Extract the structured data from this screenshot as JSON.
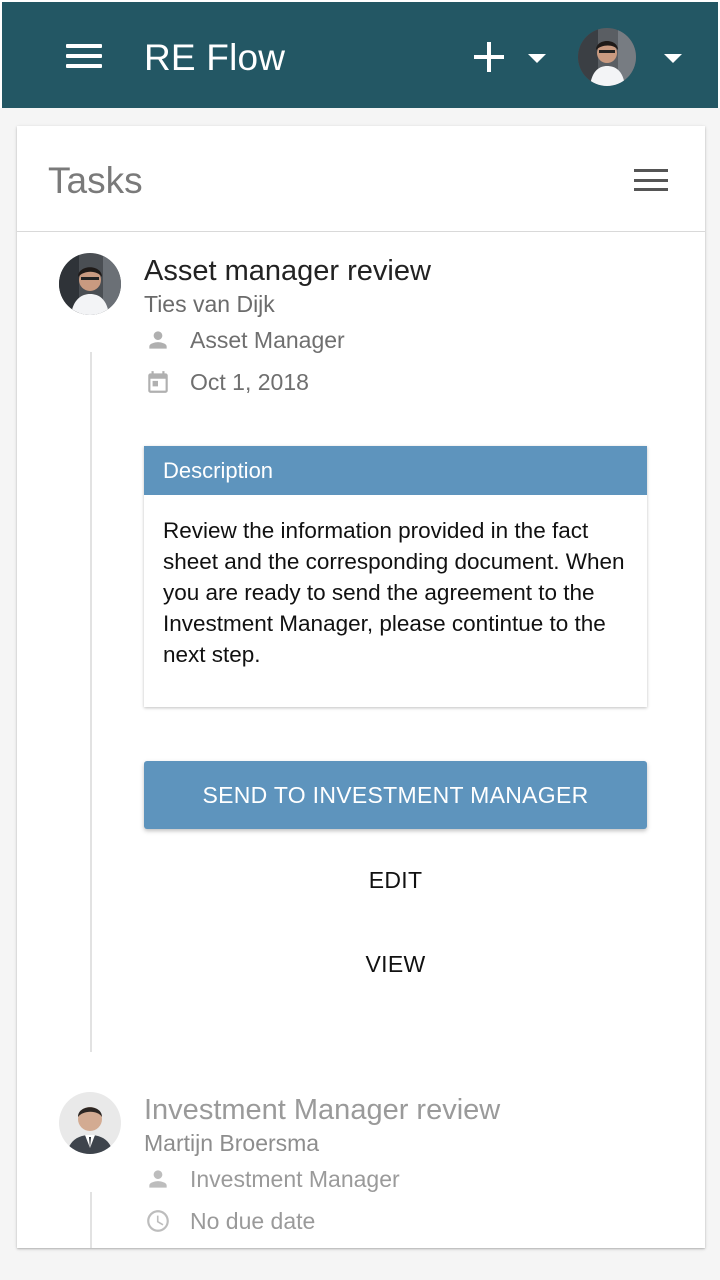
{
  "app": {
    "title": "RE Flow",
    "colors": {
      "appbar": "#235764",
      "accent": "#5e94bd"
    }
  },
  "header": {
    "menu_icon": "menu-icon",
    "add_icon": "plus-icon",
    "add_dropdown_icon": "caret-down-icon",
    "user_dropdown_icon": "caret-down-icon"
  },
  "card": {
    "title": "Tasks",
    "menu_icon": "menu-icon"
  },
  "tasks": [
    {
      "title": "Asset manager review",
      "person": "Ties van Dijk",
      "role": "Asset Manager",
      "role_icon": "person-icon",
      "date": "Oct 1, 2018",
      "date_icon": "calendar-icon",
      "description": {
        "heading": "Description",
        "text": "Review the information provided in the fact sheet and the corresponding document. When you are ready to send the agreement to the Investment Manager, please contintue to the next step."
      },
      "actions": {
        "primary": "SEND TO INVESTMENT MANAGER",
        "edit": "EDIT",
        "view": "VIEW"
      }
    },
    {
      "title": "Investment Manager review",
      "person": "Martijn Broersma",
      "role": "Investment Manager",
      "role_icon": "person-icon",
      "date": "No due date",
      "date_icon": "clock-icon"
    }
  ]
}
